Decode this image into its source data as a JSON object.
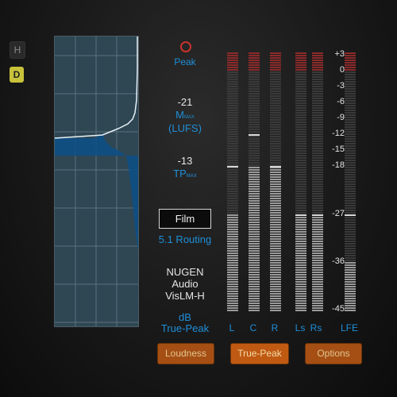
{
  "side_buttons": {
    "h": "H",
    "d": "D"
  },
  "info": {
    "peak": "Peak",
    "m_value": "-21",
    "m_label": "M",
    "m_sub": "MAX",
    "lufs": "(LUFS)",
    "tp_value": "-13",
    "tp_label": "TP",
    "tp_sub": "MAX",
    "film": "Film",
    "routing": "5.1 Routing",
    "product_1": "NUGEN",
    "product_2": "Audio",
    "product_3": "VisLM-H",
    "unit_1": "dB",
    "unit_2": "True-Peak"
  },
  "scale": [
    "+3",
    "0",
    "-3",
    "-6",
    "-9",
    "-12",
    "-15",
    "-18",
    "-27",
    "-36",
    "-45"
  ],
  "channels": [
    {
      "label": "L",
      "level_db": -27,
      "peak_hold_db": -18
    },
    {
      "label": "C",
      "level_db": -18,
      "peak_hold_db": -12
    },
    {
      "label": "R",
      "level_db": -18,
      "peak_hold_db": -18
    },
    {
      "label": "Ls",
      "level_db": -27,
      "peak_hold_db": -27
    },
    {
      "label": "Rs",
      "level_db": -27,
      "peak_hold_db": -27
    },
    {
      "label": "LFE",
      "level_db": -36,
      "peak_hold_db": -27
    }
  ],
  "buttons": [
    "Loudness",
    "True-Peak",
    "Options"
  ],
  "colors": {
    "accent": "#1f8fd8",
    "button": "#a54f14",
    "button_text": "#e3c58f",
    "meter_red": "#8b2a2a"
  }
}
